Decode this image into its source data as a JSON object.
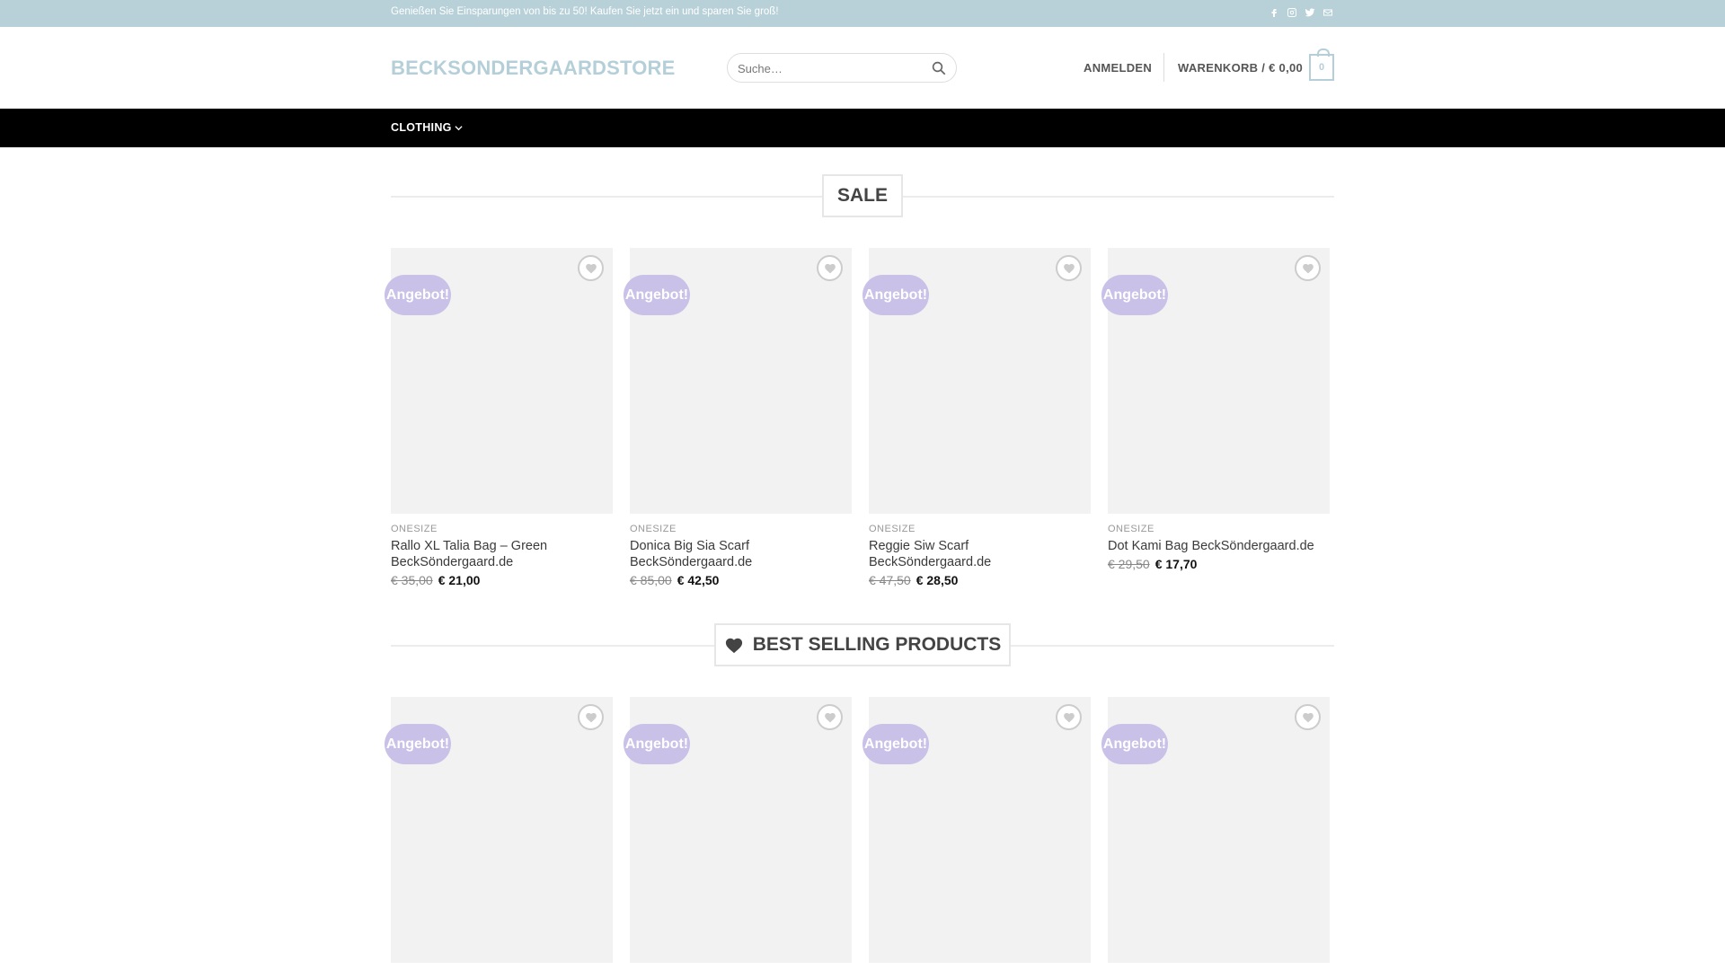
{
  "topbar": {
    "message": "Genießen Sie Einsparungen von bis zu 50! Kaufen Sie jetzt ein und sparen Sie groß!",
    "socials": [
      "facebook-icon",
      "instagram-icon",
      "twitter-icon",
      "email-icon"
    ]
  },
  "header": {
    "logo": "BECKSONDERGAARDSTORE",
    "search_placeholder": "Suche…",
    "login": "ANMELDEN",
    "cart_label": "WARENKORB / € 0,00",
    "cart_count": "0"
  },
  "nav": {
    "item": "CLOTHING"
  },
  "sections": {
    "sale": "SALE",
    "best": "BEST SELLING PRODUCTS"
  },
  "badge": "Angebot!",
  "sale_products": [
    {
      "category": "ONESIZE",
      "title": "Rallo XL Talia Bag – Green BeckSöndergaard.de",
      "old_price": "€ 35,00",
      "new_price": "€ 21,00"
    },
    {
      "category": "ONESIZE",
      "title": "Donica Big Sia Scarf BeckSöndergaard.de",
      "old_price": "€ 85,00",
      "new_price": "€ 42,50"
    },
    {
      "category": "ONESIZE",
      "title": "Reggie Siw Scarf BeckSöndergaard.de",
      "old_price": "€ 47,50",
      "new_price": "€ 28,50"
    },
    {
      "category": "ONESIZE",
      "title": "Dot Kami Bag BeckSöndergaard.de",
      "old_price": "€ 29,50",
      "new_price": "€ 17,70"
    }
  ],
  "colors": {
    "topbar": "#b8d1d9",
    "accent": "#b5cfd8",
    "badge": "#c9c1e8",
    "nav": "#000000"
  }
}
